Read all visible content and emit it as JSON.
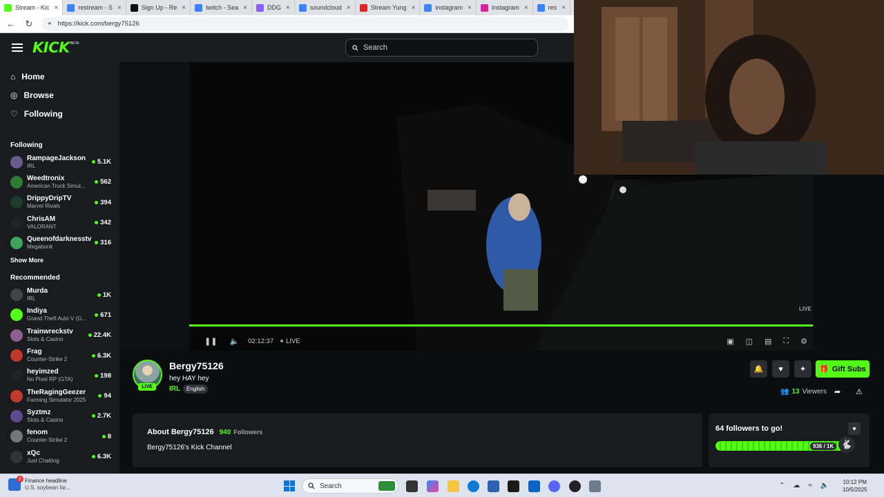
{
  "browser": {
    "tabs": [
      {
        "label": "Stream - Kic",
        "color": "#53fc18",
        "active": true
      },
      {
        "label": "restream - S",
        "color": "#3b82f6",
        "active": false
      },
      {
        "label": "Sign Up - Re",
        "color": "#111111",
        "active": false
      },
      {
        "label": "twitch - Sea",
        "color": "#3b82f6",
        "active": false
      },
      {
        "label": "DDG",
        "color": "#8b5cf6",
        "active": false
      },
      {
        "label": "soundcloud",
        "color": "#3b82f6",
        "active": false
      },
      {
        "label": "Stream Yung",
        "color": "#e02424",
        "active": false
      },
      {
        "label": "instagram",
        "color": "#3b82f6",
        "active": false
      },
      {
        "label": "Instagram",
        "color": "#d6249f",
        "active": false
      },
      {
        "label": "res",
        "color": "#3b82f6",
        "active": false
      }
    ],
    "url": "https://kick.com/bergy75126"
  },
  "header": {
    "logo": "KICK",
    "beta": "BETA",
    "search_placeholder": "Search"
  },
  "sidebar": {
    "nav": [
      {
        "label": "Home",
        "icon": "home-icon"
      },
      {
        "label": "Browse",
        "icon": "compass-icon"
      },
      {
        "label": "Following",
        "icon": "heart-icon"
      }
    ],
    "following_title": "Following",
    "following": [
      {
        "name": "RampageJackson",
        "category": "IRL",
        "viewers": "5.1K",
        "color": "#6b5a8e"
      },
      {
        "name": "Weedtronix",
        "category": "American Truck Simul...",
        "viewers": "562",
        "color": "#2e7d32"
      },
      {
        "name": "DrippyDripTV",
        "category": "Marvel Rivals",
        "viewers": "394",
        "color": "#1e3a2a"
      },
      {
        "name": "ChrisAM",
        "category": "VALORANT",
        "viewers": "342",
        "color": "#222222"
      },
      {
        "name": "Queenofdarknesstv",
        "category": "Megabonk",
        "viewers": "316",
        "color": "#3fa35a"
      }
    ],
    "show_more": "Show More",
    "recommended_title": "Recommended",
    "recommended": [
      {
        "name": "Murda",
        "category": "IRL",
        "viewers": "1K",
        "color": "#444444"
      },
      {
        "name": "Indiya",
        "category": "Grand Theft Auto V (G...",
        "viewers": "671",
        "color": "#53fc18"
      },
      {
        "name": "Trainwreckstv",
        "category": "Slots & Casino",
        "viewers": "22.4K",
        "color": "#8e5e8e"
      },
      {
        "name": "Frag",
        "category": "Counter-Strike 2",
        "viewers": "6.3K",
        "color": "#c0392b"
      },
      {
        "name": "heyimzed",
        "category": "No Pixel RP (GTA)",
        "viewers": "198",
        "color": "#222222"
      },
      {
        "name": "TheRagingGeezer",
        "category": "Farming Simulator 2025",
        "viewers": "94",
        "color": "#c0392b"
      },
      {
        "name": "Syztmz",
        "category": "Slots & Casino",
        "viewers": "2.7K",
        "color": "#5e4a8e"
      },
      {
        "name": "fenom",
        "category": "Counter-Strike 2",
        "viewers": "8",
        "color": "#777777"
      },
      {
        "name": "xQc",
        "category": "Just Chatting",
        "viewers": "6.3K",
        "color": "#333333"
      }
    ]
  },
  "player": {
    "live_tag": "LIVE",
    "time": "02:12:37",
    "live_label": "LIVE"
  },
  "channel": {
    "name": "Bergy75126",
    "title": "hey HAY hey",
    "category": "IRL",
    "language": "English",
    "live_badge": "LIVE",
    "gift_label": "Gift Subs",
    "viewers_count": "13",
    "viewers_label": "Viewers"
  },
  "about": {
    "title": "About Bergy75126",
    "followers_count": "940",
    "followers_label": "Followers",
    "description": "Bergy75126's Kick Channel"
  },
  "goal": {
    "title": "64 followers to go!",
    "label": "936 / 1K",
    "progress": 0.936
  },
  "taskbar": {
    "news_title": "Finance headline",
    "news_sub": "U.S. soybean far...",
    "news_badge": "2",
    "search_label": "Search",
    "time": "10:12 PM",
    "date": "10/5/2025"
  }
}
